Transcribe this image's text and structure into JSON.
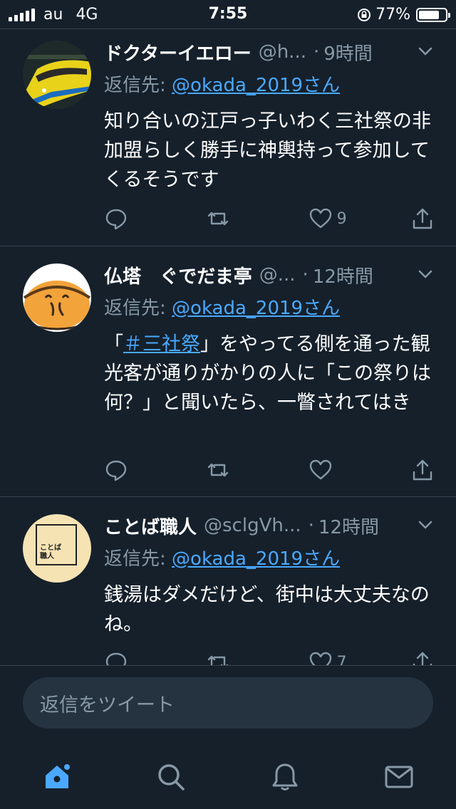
{
  "status_bar": {
    "carrier": "au",
    "network": "4G",
    "time": "7:55",
    "battery": "77%",
    "battery_level": 0.77
  },
  "tweets": [
    {
      "name": "ドクターイエロー",
      "handle": "@h...",
      "dot": "·",
      "time": "9時間",
      "reply_prefix": "返信先: ",
      "reply_to": "@okada_2019さん",
      "text": "知り合いの江戸っ子いわく三社祭の非加盟らしく勝手に神輿持って参加してくるそうです",
      "likes": "9",
      "avatar": "yellow-train-avatar"
    },
    {
      "name": "仏塔　ぐでだま亭",
      "handle": "@...",
      "dot": "·",
      "time": "12時間",
      "reply_prefix": "返信先: ",
      "reply_to": "@okada_2019さん",
      "text_before": "「",
      "hashtag": "＃三社祭",
      "text_after": "」をやってる側を通った観光客が通りがかりの人に「この祭りは何？」と聞いたら、一瞥されてはき",
      "likes": "",
      "avatar": "gudetama-avatar"
    },
    {
      "name": "ことば職人",
      "handle": "@sclgVh...",
      "dot": "·",
      "time": "12時間",
      "reply_prefix": "返信先: ",
      "reply_to": "@okada_2019さん",
      "text": "銭湯はダメだけど、街中は大丈夫なのね。",
      "likes": "7",
      "avatar_text": "ことば\n職人"
    }
  ],
  "reply_input": {
    "placeholder": "返信をツイート"
  },
  "tabbar": {
    "items": [
      "home-icon",
      "search-icon",
      "notifications-icon",
      "messages-icon"
    ]
  },
  "colors": {
    "background": "#15202b",
    "accent": "#1da1f2",
    "secondary_text": "#8899a6",
    "divider": "#38444d"
  }
}
